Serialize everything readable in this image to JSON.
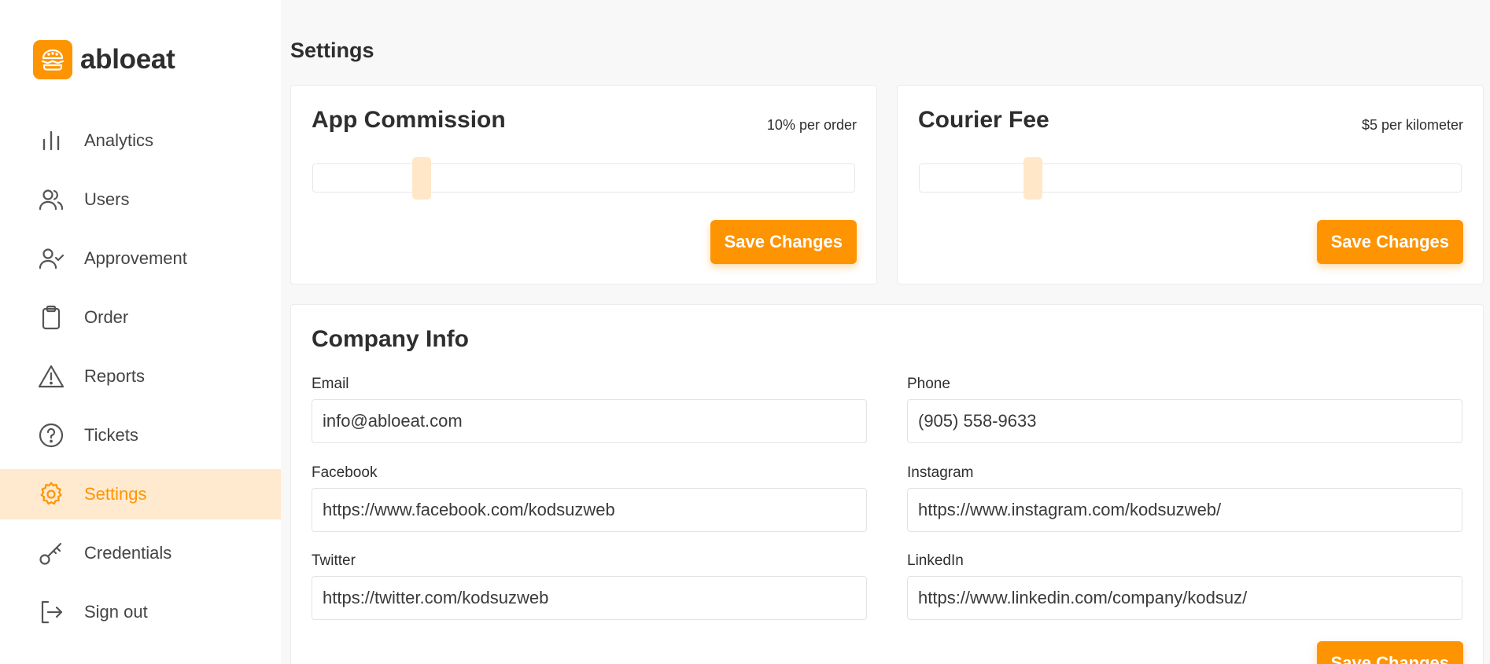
{
  "brand": {
    "name": "abloeat",
    "accent": "#fe9402"
  },
  "sidebar": {
    "items": [
      {
        "label": "Analytics",
        "icon": "bar-chart-icon",
        "active": false
      },
      {
        "label": "Users",
        "icon": "users-icon",
        "active": false
      },
      {
        "label": "Approvement",
        "icon": "user-check-icon",
        "active": false
      },
      {
        "label": "Order",
        "icon": "clipboard-icon",
        "active": false
      },
      {
        "label": "Reports",
        "icon": "warning-triangle-icon",
        "active": false
      },
      {
        "label": "Tickets",
        "icon": "help-circle-icon",
        "active": false
      },
      {
        "label": "Settings",
        "icon": "gear-icon",
        "active": true
      },
      {
        "label": "Credentials",
        "icon": "key-icon",
        "active": false
      },
      {
        "label": "Sign out",
        "icon": "sign-out-icon",
        "active": false
      }
    ]
  },
  "page": {
    "title": "Settings"
  },
  "commission": {
    "title": "App Commission",
    "value_text": "10% per order",
    "slider_fraction": 0.2,
    "save_label": "Save Changes"
  },
  "courier": {
    "title": "Courier Fee",
    "value_text": "$5 per kilometer",
    "slider_fraction": 0.21,
    "save_label": "Save Changes"
  },
  "company": {
    "title": "Company Info",
    "email": {
      "label": "Email",
      "value": "info@abloeat.com"
    },
    "phone": {
      "label": "Phone",
      "value": "(905) 558-9633"
    },
    "facebook": {
      "label": "Facebook",
      "value": "https://www.facebook.com/kodsuzweb"
    },
    "instagram": {
      "label": "Instagram",
      "value": "https://www.instagram.com/kodsuzweb/"
    },
    "twitter": {
      "label": "Twitter",
      "value": "https://twitter.com/kodsuzweb"
    },
    "linkedin": {
      "label": "LinkedIn",
      "value": "https://www.linkedin.com/company/kodsuz/"
    },
    "save_label": "Save Changes"
  }
}
